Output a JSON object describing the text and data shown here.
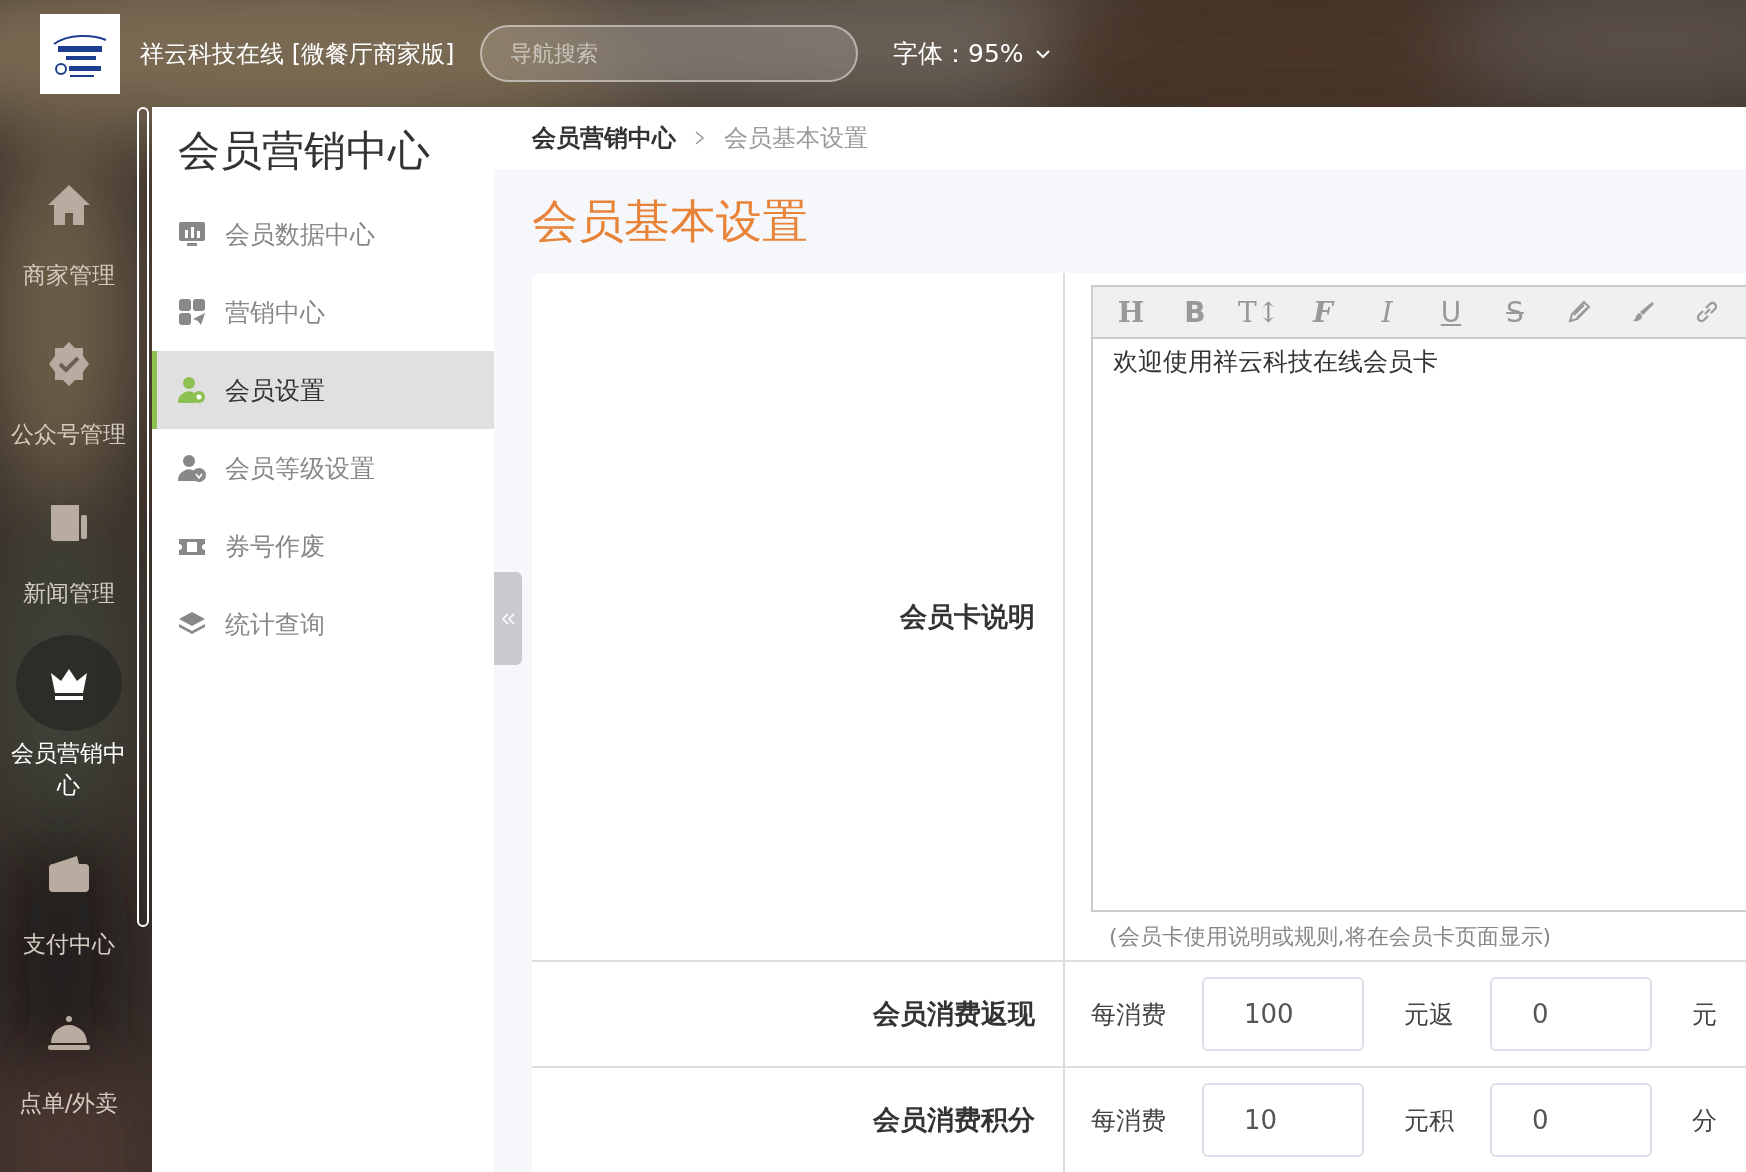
{
  "app_title": "祥云科技在线 [微餐厅商家版]",
  "search": {
    "placeholder": "导航搜索"
  },
  "font_size": {
    "label": "字体：95%"
  },
  "nav": [
    {
      "label": "商家管理",
      "selected": false
    },
    {
      "label": "公众号管理",
      "selected": false
    },
    {
      "label": "新闻管理",
      "selected": false
    },
    {
      "label": "会员营销中心",
      "selected": true
    },
    {
      "label": "支付中心",
      "selected": false
    },
    {
      "label": "点单/外卖",
      "selected": false
    }
  ],
  "submenu": {
    "title": "会员营销中心",
    "items": [
      {
        "label": "会员数据中心",
        "selected": false
      },
      {
        "label": "营销中心",
        "selected": false
      },
      {
        "label": "会员设置",
        "selected": true
      },
      {
        "label": "会员等级设置",
        "selected": false
      },
      {
        "label": "券号作废",
        "selected": false
      },
      {
        "label": "统计查询",
        "selected": false
      }
    ]
  },
  "breadcrumb": [
    "会员营销中心",
    "会员基本设置"
  ],
  "page_title": "会员基本设置",
  "form": [
    {
      "kind": "editor",
      "label": "会员卡说明",
      "toolbar": [
        {
          "kind": "heading",
          "label": "H"
        },
        {
          "kind": "bold",
          "label": "B"
        },
        {
          "kind": "size",
          "label": "T↕"
        },
        {
          "kind": "font",
          "label": "F"
        },
        {
          "kind": "italic",
          "label": "I"
        },
        {
          "kind": "underline",
          "label": "U"
        },
        {
          "kind": "strike",
          "label": "S"
        },
        {
          "kind": "pencil"
        },
        {
          "kind": "brush"
        },
        {
          "kind": "link"
        }
      ],
      "content": "欢迎使用祥云科技在线会员卡",
      "hint": "(会员卡使用说明或规则,将在会员卡页面显示)"
    },
    {
      "kind": "rule",
      "label": "会员消费返现",
      "prefix": "每消费",
      "value1": "100",
      "middle": "元返",
      "value2": "0",
      "suffix": "元"
    },
    {
      "kind": "rule",
      "label": "会员消费积分",
      "prefix": "每消费",
      "value1": "10",
      "middle": "元积",
      "value2": "0",
      "suffix": "分"
    }
  ]
}
